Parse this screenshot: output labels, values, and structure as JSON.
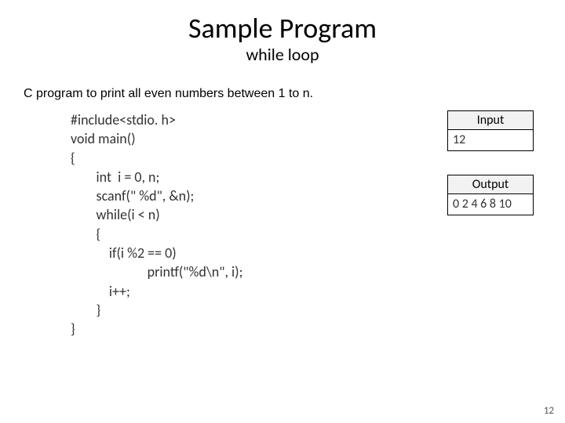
{
  "title": "Sample Program",
  "subtitle": "while loop",
  "description": "C program to print all even numbers between 1 to n.",
  "code": {
    "l1": "#include<stdio. h>",
    "l2": "void main()",
    "l3": "{",
    "l4": "        int  i = 0, n;",
    "l5": "        scanf(\" %d\", &n);",
    "l6": "        while(i < n)",
    "l7": "        {",
    "l8": "            if(i %2 == 0)",
    "l9": "                        printf(\"%d\\n\", i);",
    "l10": "            i++;",
    "l11": "        }",
    "l12": "}"
  },
  "input": {
    "header": "Input",
    "body": "12"
  },
  "output": {
    "header": "Output",
    "body": "0\n2\n4\n6\n8\n10"
  },
  "page_number": "12"
}
